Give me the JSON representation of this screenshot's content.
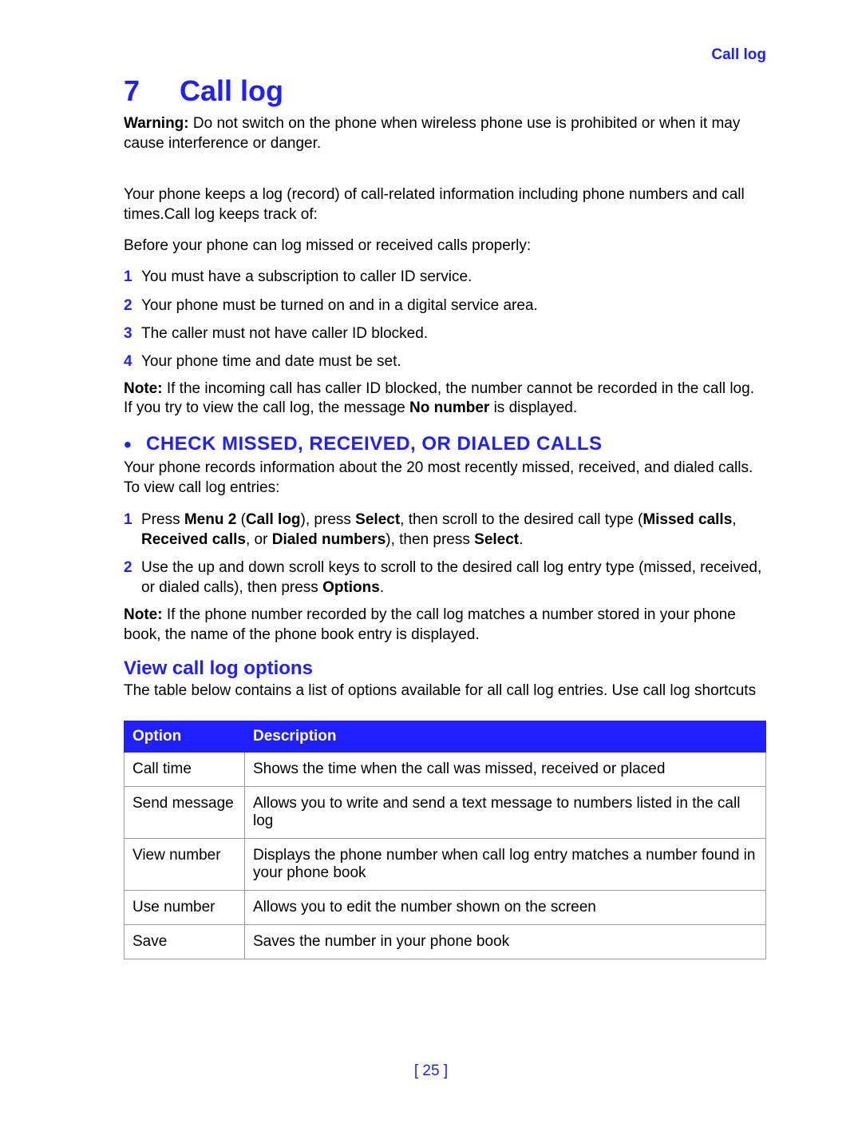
{
  "header": {
    "section": "Call log"
  },
  "chapter": {
    "number": "7",
    "title": "Call log"
  },
  "warning": {
    "lead": "Warning:",
    "text": " Do not switch on the phone when wireless phone use is prohibited or when it may cause interference or danger."
  },
  "intro1": "Your phone keeps a log (record) of call-related information including phone numbers and call times.Call log keeps track of:",
  "intro2": "Before your phone can log missed or received calls properly:",
  "prerequisites": [
    "You must have a subscription to caller ID service.",
    "Your phone must be turned on and in a digital service area.",
    "The caller must not have caller ID blocked.",
    "Your phone time and date must be set."
  ],
  "note1": {
    "lead": "Note:",
    "before": " If the incoming call has caller ID blocked, the number cannot be recorded in the call log. If you try to view the call log, the message ",
    "bold": "No number",
    "after": " is displayed."
  },
  "section1": {
    "heading": "CHECK MISSED, RECEIVED, OR DIALED CALLS",
    "intro": "Your phone records information about the 20 most recently missed, received, and dialed calls. To view call log entries:",
    "step1": {
      "a": "Press ",
      "b": "Menu 2",
      "c": " (",
      "d": "Call log",
      "e": "), press ",
      "f": "Select",
      "g": ", then scroll to the desired call type (",
      "h": "Missed calls",
      "i": ", ",
      "j": "Received calls",
      "k": ", or ",
      "l": "Dialed numbers",
      "m": "), then press ",
      "n": "Select",
      "o": "."
    },
    "step2": {
      "a": "Use the up and down scroll keys to scroll to the desired call log entry type (missed, received, or dialed calls), then press ",
      "b": "Options",
      "c": "."
    }
  },
  "note2": {
    "lead": "Note:",
    "text": " If the phone number recorded by the call log matches a number stored in your phone book, the name of the phone book entry is displayed."
  },
  "section2": {
    "heading": "View call log options",
    "intro": "The table below contains a list of options available for all call log entries. Use call log shortcuts"
  },
  "table": {
    "headers": {
      "c1": "Option",
      "c2": "Description"
    },
    "rows": [
      {
        "c1": "Call time",
        "c2": "Shows the time when the call was missed, received or placed"
      },
      {
        "c1": "Send message",
        "c2": "Allows you to write and send a text message to numbers listed in the call log"
      },
      {
        "c1": "View number",
        "c2": "Displays the phone number when call log entry matches a number found in your phone book"
      },
      {
        "c1": "Use number",
        "c2": "Allows you to edit the number shown on the screen"
      },
      {
        "c1": "Save",
        "c2": "Saves the number in your phone book"
      }
    ]
  },
  "page_number": "[ 25 ]"
}
